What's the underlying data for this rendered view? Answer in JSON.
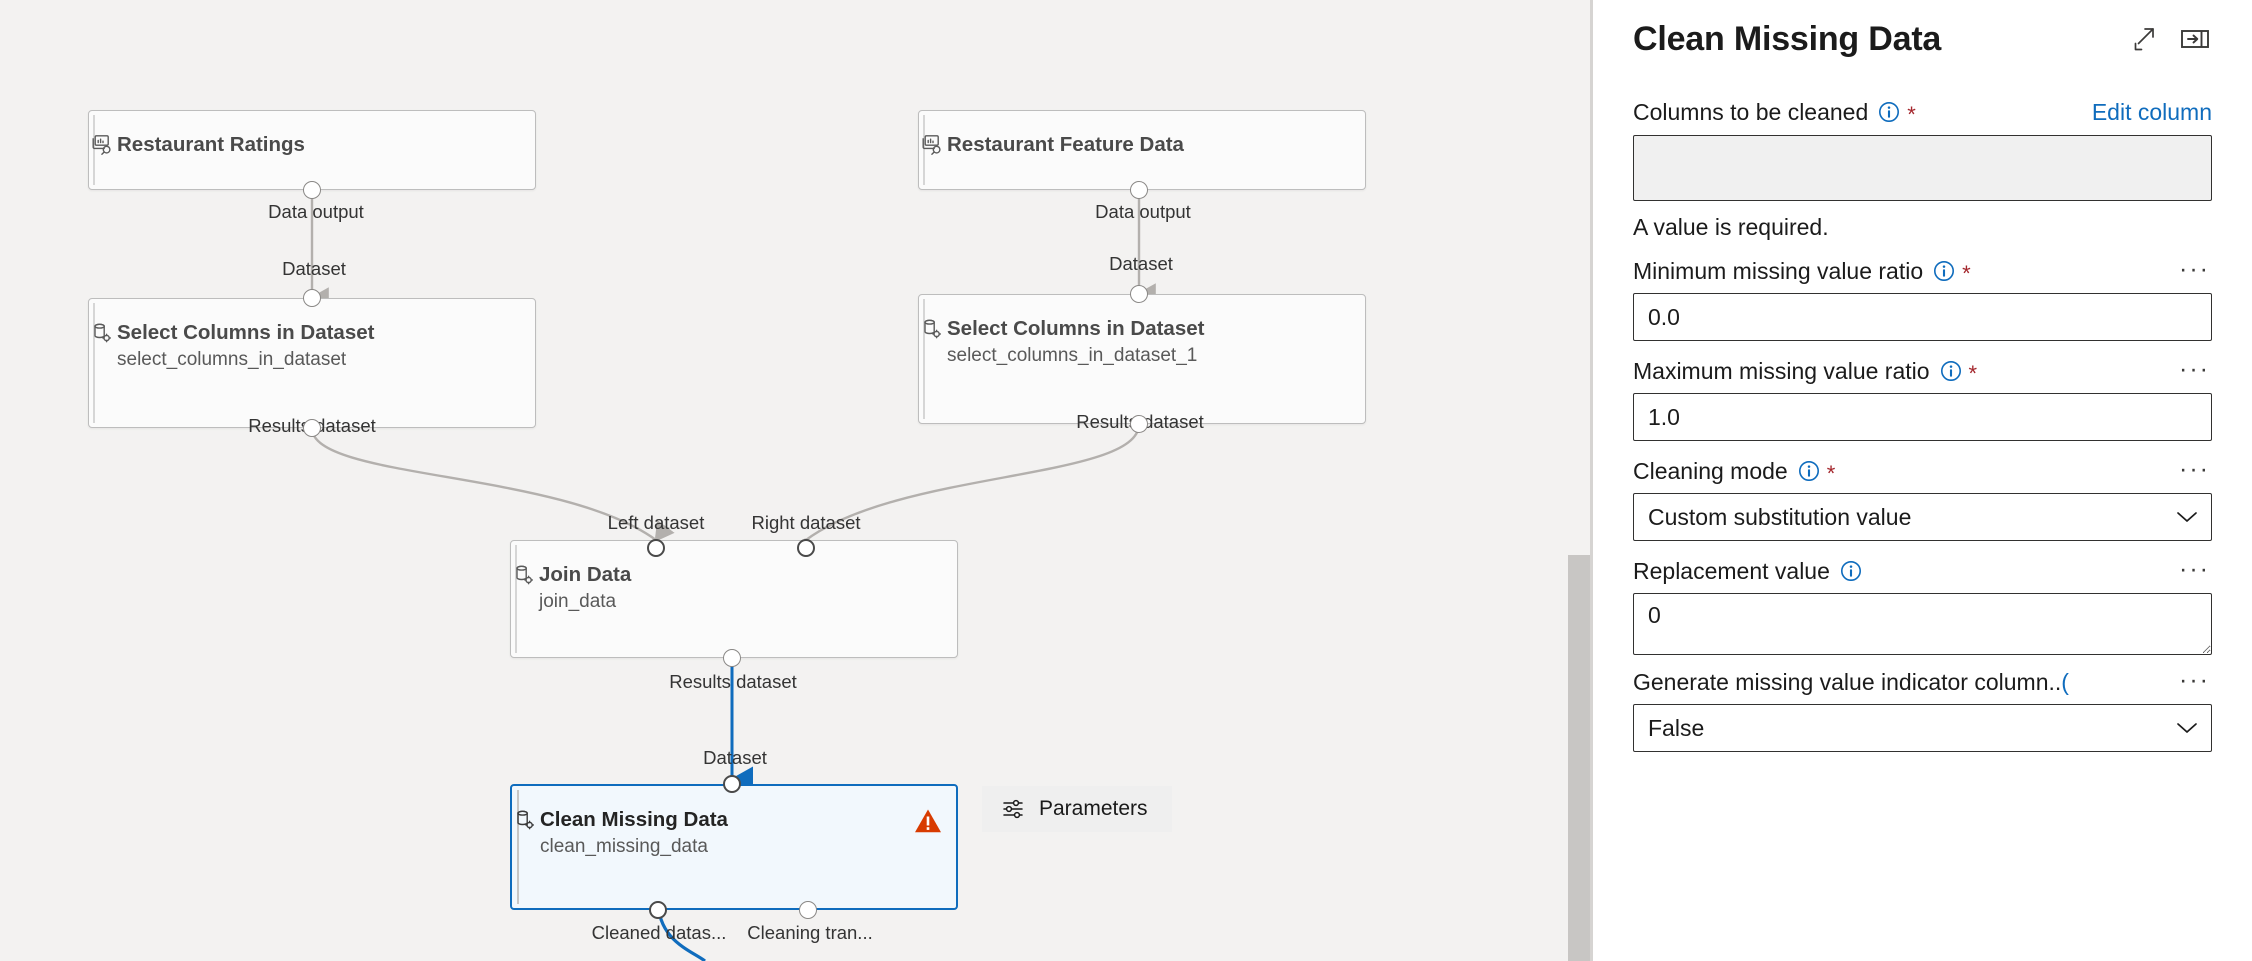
{
  "canvas": {
    "nodes": [
      {
        "id": "restaurant-ratings",
        "title": "Restaurant Ratings",
        "subtitle": "",
        "icon": "dataset-search-icon",
        "selected": false,
        "warning": false
      },
      {
        "id": "restaurant-feature-data",
        "title": "Restaurant Feature Data",
        "subtitle": "",
        "icon": "dataset-search-icon",
        "selected": false,
        "warning": false
      },
      {
        "id": "select-columns-in-dataset",
        "title": "Select Columns in Dataset",
        "subtitle": "select_columns_in_dataset",
        "icon": "module-gear-icon",
        "selected": false,
        "warning": false
      },
      {
        "id": "select-columns-in-dataset-1",
        "title": "Select Columns in Dataset",
        "subtitle": "select_columns_in_dataset_1",
        "icon": "module-gear-icon",
        "selected": false,
        "warning": false
      },
      {
        "id": "join-data",
        "title": "Join Data",
        "subtitle": "join_data",
        "icon": "module-gear-icon",
        "selected": false,
        "warning": false
      },
      {
        "id": "clean-missing-data",
        "title": "Clean Missing Data",
        "subtitle": "clean_missing_data",
        "icon": "module-gear-icon",
        "selected": true,
        "warning": true
      }
    ],
    "port_labels": [
      "Data output",
      "Dataset",
      "Results dataset",
      "Data output",
      "Dataset",
      "Results dataset",
      "Left dataset",
      "Right dataset",
      "Results dataset",
      "Dataset",
      "Cleaned datas...",
      "Cleaning tran..."
    ],
    "parameters_button": "Parameters"
  },
  "panel": {
    "title": "Clean Missing Data",
    "expand_label": "expand-icon",
    "collapse_label": "collapse-panel-icon",
    "fields": {
      "columns": {
        "label": "Columns to be cleaned",
        "required": "*",
        "edit_link": "Edit column",
        "value": "",
        "error": "A value is required."
      },
      "min_ratio": {
        "label": "Minimum missing value ratio",
        "required": "*",
        "value": "0.0",
        "more": "···"
      },
      "max_ratio": {
        "label": "Maximum missing value ratio",
        "required": "*",
        "value": "1.0",
        "more": "···"
      },
      "cleaning_mode": {
        "label": "Cleaning mode",
        "required": "*",
        "value": "Custom substitution value",
        "more": "···"
      },
      "replacement_value": {
        "label": "Replacement value",
        "required": "",
        "value": "0",
        "more": "···"
      },
      "generate_indicator": {
        "label": "Generate missing value indicator column..",
        "required": "",
        "value": "False",
        "more": "···"
      }
    }
  },
  "colors": {
    "accent": "#0f6cbd",
    "required": "#a4262c",
    "warning": "#d83b01",
    "canvas_bg": "#f3f2f1",
    "selected_edge": "#0f6cbd"
  }
}
